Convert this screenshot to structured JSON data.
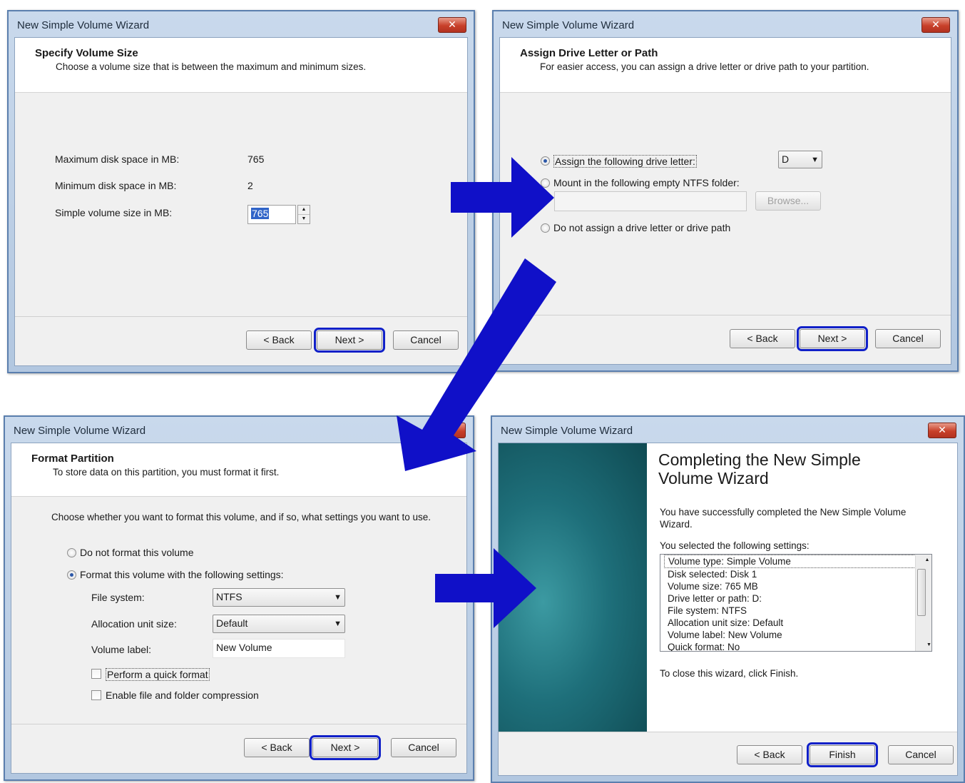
{
  "wizard_title": "New Simple Volume Wizard",
  "close_glyph": "✕",
  "accent_focus_color": "#1020c8",
  "arrow_color": "#1010c8",
  "buttons": {
    "back": "< Back",
    "next": "Next >",
    "cancel": "Cancel",
    "finish": "Finish",
    "browse": "Browse..."
  },
  "step1": {
    "header_title": "Specify Volume Size",
    "header_subtitle": "Choose a volume size that is between the maximum and minimum sizes.",
    "max_label": "Maximum disk space in MB:",
    "max_value": "765",
    "min_label": "Minimum disk space in MB:",
    "min_value": "2",
    "size_label": "Simple volume size in MB:",
    "size_value": "765"
  },
  "step2": {
    "header_title": "Assign Drive Letter or Path",
    "header_subtitle": "For easier access, you can assign a drive letter or drive path to your partition.",
    "opt_letter": "Assign the following drive letter:",
    "drive_letter": "D",
    "opt_mount": "Mount in the following empty NTFS folder:",
    "opt_none": "Do not assign a drive letter or drive path"
  },
  "step3": {
    "header_title": "Format Partition",
    "header_subtitle": "To store data on this partition, you must format it first.",
    "intro": "Choose whether you want to format this volume, and if so, what settings you want to use.",
    "opt_no_format": "Do not format this volume",
    "opt_format": "Format this volume with the following settings:",
    "fs_label": "File system:",
    "fs_value": "NTFS",
    "alloc_label": "Allocation unit size:",
    "alloc_value": "Default",
    "vol_label": "Volume label:",
    "vol_value": "New Volume",
    "quick_format": "Perform a quick format",
    "compression": "Enable file and folder compression"
  },
  "step4": {
    "heading_line1": "Completing the New Simple",
    "heading_line2": "Volume Wizard",
    "success": "You have successfully completed the New Simple Volume Wizard.",
    "settings_intro": "You selected the following settings:",
    "settings": [
      "Volume type: Simple Volume",
      "Disk selected: Disk 1",
      "Volume size: 765 MB",
      "Drive letter or path: D:",
      "File system: NTFS",
      "Allocation unit size: Default",
      "Volume label: New Volume",
      "Quick format: No"
    ],
    "close_hint": "To close this wizard, click Finish."
  }
}
